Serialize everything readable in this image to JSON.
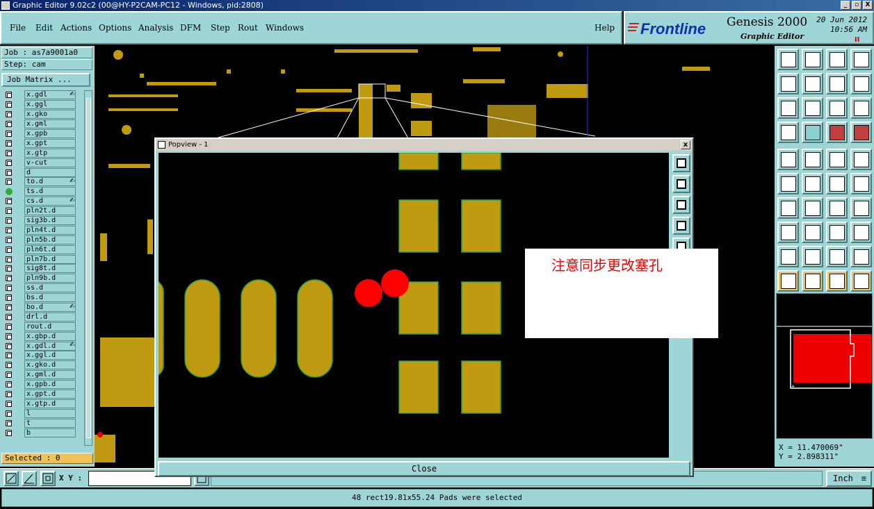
{
  "window": {
    "title": "Graphic Editor 9.02c2 (00@HY-P2CAM-PC12 - Windows, pid:2808)",
    "controls": [
      "_",
      "▫",
      "X"
    ]
  },
  "menu": {
    "items": [
      "File",
      "Edit",
      "Actions",
      "Options",
      "Analysis",
      "DFM",
      "Step",
      "Rout",
      "Windows"
    ],
    "help": "Help"
  },
  "brand": {
    "logo": "Frontline",
    "product": "Genesis 2000",
    "subtitle": "Graphic Editor",
    "date": "20 Jun 2012",
    "time": "10:56 AM",
    "pause": "II"
  },
  "job": {
    "job_line": "Job : as7a9001a0",
    "step_line": "Step: cam",
    "matrix_button": "Job Matrix ..."
  },
  "layers": [
    {
      "name": "x.gdl",
      "mark": "✍"
    },
    {
      "name": "x.ggl"
    },
    {
      "name": "x.gko"
    },
    {
      "name": "x.gml"
    },
    {
      "name": "x.gpb"
    },
    {
      "name": "x.gpt"
    },
    {
      "name": "x.gtp"
    },
    {
      "name": "v-cut"
    },
    {
      "name": "d"
    },
    {
      "name": "to.d",
      "mark": "✍"
    },
    {
      "name": "ts.d",
      "active": true
    },
    {
      "name": "cs.d",
      "mark": "✍"
    },
    {
      "name": "pln2t.d"
    },
    {
      "name": "sig3b.d"
    },
    {
      "name": "pln4t.d"
    },
    {
      "name": "pln5b.d"
    },
    {
      "name": "pln6t.d"
    },
    {
      "name": "pln7b.d"
    },
    {
      "name": "sig8t.d"
    },
    {
      "name": "pln9b.d"
    },
    {
      "name": "ss.d"
    },
    {
      "name": "bs.d"
    },
    {
      "name": "bo.d",
      "mark": "✍"
    },
    {
      "name": "drl.d"
    },
    {
      "name": "rout.d"
    },
    {
      "name": "x.gbp.d"
    },
    {
      "name": "x.gdl.d",
      "mark": "✍"
    },
    {
      "name": "x.ggl.d"
    },
    {
      "name": "x.gko.d"
    },
    {
      "name": "x.gml.d"
    },
    {
      "name": "x.gpb.d"
    },
    {
      "name": "x.gpt.d"
    },
    {
      "name": "x.gtp.d"
    },
    {
      "name": "l"
    },
    {
      "name": "t"
    },
    {
      "name": "b"
    }
  ],
  "selected": "Selected : 0",
  "popview": {
    "title": "Popview - 1",
    "close_label": "Close"
  },
  "note": "注意同步更改塞孔",
  "coords": {
    "x": "X = 11.470069\"",
    "y": "Y = 2.898311\""
  },
  "bottom": {
    "xy_label": "X Y :",
    "xy_value": "",
    "message": "",
    "units": "Inch"
  },
  "status": "48 rect19.81x55.24 Pads were selected",
  "colors": {
    "panel": "#9ed5d6",
    "pad": "#c09a10",
    "pad_outline": "#2fa02f",
    "highlight": "#ff0000",
    "selected_bar": "#f0c35a"
  }
}
